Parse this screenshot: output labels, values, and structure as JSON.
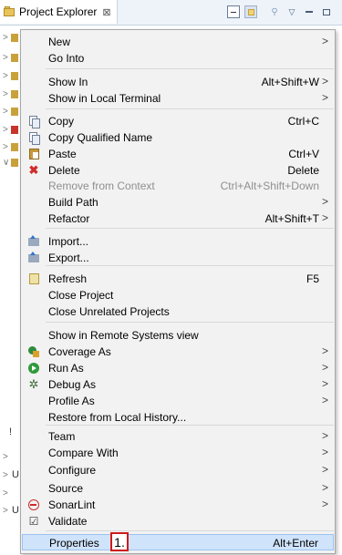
{
  "view": {
    "title": "Project Explorer",
    "close_glyph": "⊠"
  },
  "tree": {
    "rows": [
      {
        "arrow": ">",
        "icon": "folder-icon"
      },
      {
        "arrow": ">",
        "icon": "folder-icon"
      },
      {
        "arrow": ">",
        "icon": "folder-icon"
      },
      {
        "arrow": ">",
        "icon": "folder-icon"
      },
      {
        "arrow": ">",
        "icon": "folder-icon"
      },
      {
        "arrow": ">",
        "icon": "error-folder-icon"
      },
      {
        "arrow": ">",
        "icon": "folder-icon"
      },
      {
        "arrow": "∨",
        "icon": "folder-icon"
      }
    ],
    "bottom_rows": [
      {
        "arrow": ">",
        "text": ""
      },
      {
        "arrow": ">",
        "text": "U"
      },
      {
        "arrow": ">",
        "text": ""
      },
      {
        "arrow": ">",
        "text": "U"
      }
    ]
  },
  "menu": {
    "items": [
      {
        "label": "New",
        "accel": "",
        "submenu": true,
        "icon": ""
      },
      {
        "label": "Go Into",
        "accel": "",
        "submenu": false,
        "icon": ""
      },
      {
        "label": "Show In",
        "accel": "Alt+Shift+W",
        "submenu": true,
        "icon": ""
      },
      {
        "label": "Show in Local Terminal",
        "accel": "",
        "submenu": true,
        "icon": ""
      },
      {
        "label": "Copy",
        "accel": "Ctrl+C",
        "submenu": false,
        "icon": "copy"
      },
      {
        "label": "Copy Qualified Name",
        "accel": "",
        "submenu": false,
        "icon": "copy"
      },
      {
        "label": "Paste",
        "accel": "Ctrl+V",
        "submenu": false,
        "icon": "paste"
      },
      {
        "label": "Delete",
        "accel": "Delete",
        "submenu": false,
        "icon": "delete"
      },
      {
        "label": "Remove from Context",
        "accel": "Ctrl+Alt+Shift+Down",
        "submenu": false,
        "icon": "",
        "disabled": true
      },
      {
        "label": "Build Path",
        "accel": "",
        "submenu": true,
        "icon": ""
      },
      {
        "label": "Refactor",
        "accel": "Alt+Shift+T",
        "submenu": true,
        "icon": ""
      },
      {
        "label": "Import...",
        "accel": "",
        "submenu": false,
        "icon": "import"
      },
      {
        "label": "Export...",
        "accel": "",
        "submenu": false,
        "icon": "export"
      },
      {
        "label": "Refresh",
        "accel": "F5",
        "submenu": false,
        "icon": "refresh"
      },
      {
        "label": "Close Project",
        "accel": "",
        "submenu": false,
        "icon": ""
      },
      {
        "label": "Close Unrelated Projects",
        "accel": "",
        "submenu": false,
        "icon": ""
      },
      {
        "label": "Show in Remote Systems view",
        "accel": "",
        "submenu": false,
        "icon": ""
      },
      {
        "label": "Coverage As",
        "accel": "",
        "submenu": true,
        "icon": "coverage"
      },
      {
        "label": "Run As",
        "accel": "",
        "submenu": true,
        "icon": "run"
      },
      {
        "label": "Debug As",
        "accel": "",
        "submenu": true,
        "icon": "debug"
      },
      {
        "label": "Profile As",
        "accel": "",
        "submenu": true,
        "icon": ""
      },
      {
        "label": "Restore from Local History...",
        "accel": "",
        "submenu": false,
        "icon": ""
      },
      {
        "label": "Team",
        "accel": "",
        "submenu": true,
        "icon": ""
      },
      {
        "label": "Compare With",
        "accel": "",
        "submenu": true,
        "icon": ""
      },
      {
        "label": "Configure",
        "accel": "",
        "submenu": true,
        "icon": ""
      },
      {
        "label": "Source",
        "accel": "",
        "submenu": true,
        "icon": ""
      },
      {
        "label": "SonarLint",
        "accel": "",
        "submenu": true,
        "icon": "sonarlint"
      },
      {
        "label": "Validate",
        "accel": "",
        "submenu": false,
        "icon": "validate"
      },
      {
        "label": "Properties",
        "accel": "Alt+Enter",
        "submenu": false,
        "icon": "",
        "highlighted": true
      }
    ],
    "submenu_glyph": ">",
    "annotation": "1."
  }
}
